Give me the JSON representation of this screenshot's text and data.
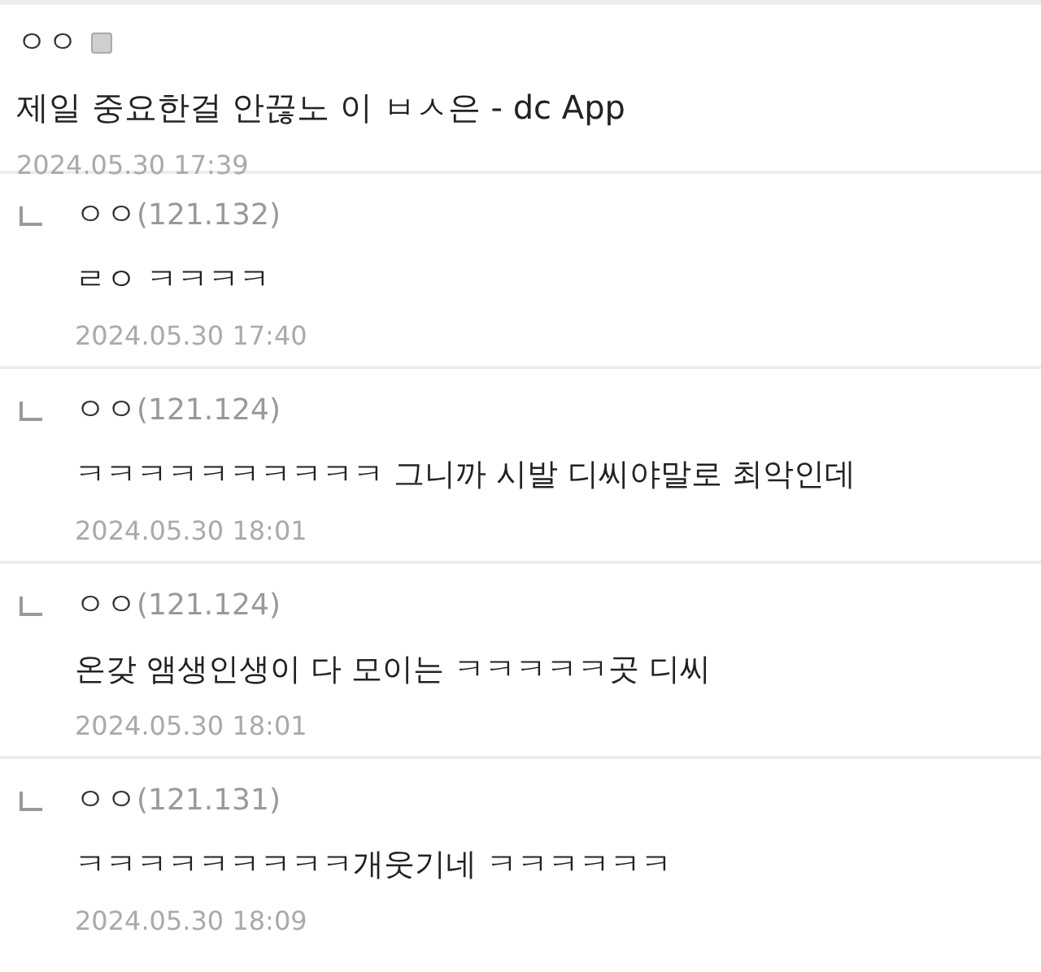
{
  "post": {
    "author": "ㅇㅇ",
    "title": "제일 중요한걸 안끊노 이 ㅂㅅ은 - dc App",
    "date": "2024.05.30 17:39"
  },
  "comments": [
    {
      "author": "ㅇㅇ",
      "ip": "(121.132)",
      "text": "ㄹㅇ ㅋㅋㅋㅋ",
      "date": "2024.05.30 17:40"
    },
    {
      "author": "ㅇㅇ",
      "ip": "(121.124)",
      "text": "ㅋㅋㅋㅋㅋㅋㅋㅋㅋㅋ 그니까 시발 디씨야말로 최악인데",
      "date": "2024.05.30 18:01"
    },
    {
      "author": "ㅇㅇ",
      "ip": "(121.124)",
      "text": "온갖 앰생인생이 다 모이는 ㅋㅋㅋㅋㅋ곳 디씨",
      "date": "2024.05.30 18:01"
    },
    {
      "author": "ㅇㅇ",
      "ip": "(121.131)",
      "text": "ㅋㅋㅋㅋㅋㅋㅋㅋㅋ개웃기네 ㅋㅋㅋㅋㅋㅋ",
      "date": "2024.05.30 18:09"
    }
  ]
}
